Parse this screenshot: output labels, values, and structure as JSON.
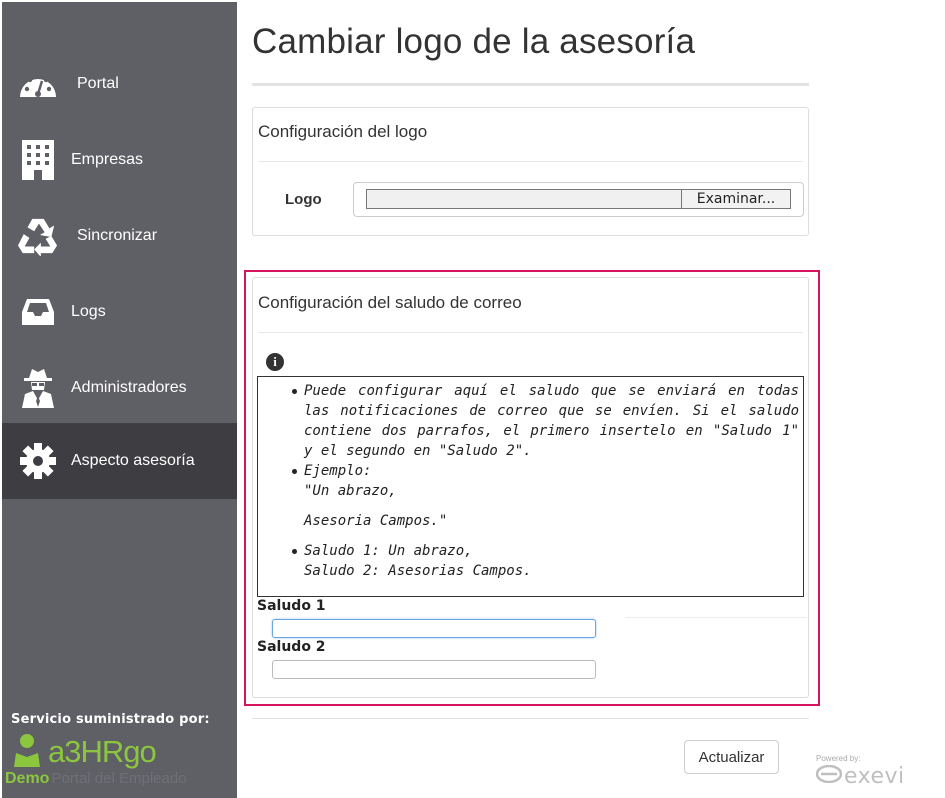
{
  "sidebar": {
    "items": [
      {
        "label": "Portal",
        "icon": "dashboard-icon"
      },
      {
        "label": "Empresas",
        "icon": "building-icon"
      },
      {
        "label": "Sincronizar",
        "icon": "recycle-icon"
      },
      {
        "label": "Logs",
        "icon": "inbox-icon"
      },
      {
        "label": "Administradores",
        "icon": "user-secret-icon"
      },
      {
        "label": "Aspecto asesoría",
        "icon": "gear-icon",
        "active": true
      }
    ],
    "footer": {
      "service_label": "Servicio suministrado por:",
      "brand_a3": "a3",
      "brand_hr": "HR",
      "brand_go": "go",
      "demo": "Demo",
      "portal": "Portal del Empleado"
    }
  },
  "main": {
    "title": "Cambiar logo de la asesoría",
    "logo_panel": {
      "heading": "Configuración del logo",
      "field_label": "Logo",
      "file_value": "",
      "browse_button": "Examinar..."
    },
    "greeting_panel": {
      "heading": "Configuración del saludo de correo",
      "help": {
        "item1": "Puede configurar aquí el saludo que se enviará en todas las notificaciones de correo que se envíen. Si el saludo contiene dos parrafos, el primero insertelo en \"Saludo 1\" y el segundo en \"Saludo 2\".",
        "item2_title": "Ejemplo:",
        "item2_line1": "\"Un abrazo,",
        "item2_line2": "Asesoria Campos.\"",
        "item3_line1": "Saludo 1: Un abrazo,",
        "item3_line2": "Saludo 2: Asesorias Campos."
      },
      "saludo1_label": "Saludo 1",
      "saludo1_value": "",
      "saludo2_label": "Saludo 2",
      "saludo2_value": ""
    },
    "update_button": "Actualizar"
  },
  "powered_by": {
    "label": "Powered by:",
    "brand": "exevi"
  },
  "colors": {
    "sidebar_bg": "#5f5f66",
    "sidebar_active": "#3d3d42",
    "highlight_border": "#d6145f",
    "brand_green": "#8cc63f"
  }
}
